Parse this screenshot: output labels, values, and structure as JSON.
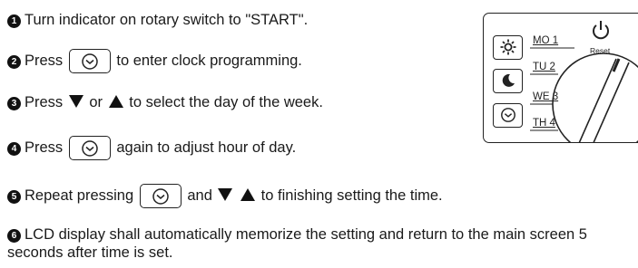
{
  "steps": {
    "s1": {
      "num": "1",
      "text": "Turn indicator on rotary switch to \"START\"."
    },
    "s2": {
      "num": "2",
      "before": "Press",
      "after": "to enter clock programming."
    },
    "s3": {
      "num": "3",
      "before": "Press",
      "mid": "or",
      "after": "to select the day of the week."
    },
    "s4": {
      "num": "4",
      "before": "Press",
      "after": "again to adjust hour of day."
    },
    "s5": {
      "num": "5",
      "before": "Repeat pressing",
      "mid": "and",
      "after": "to finishing setting the time."
    },
    "s6": {
      "num": "6",
      "text": "LCD display shall automatically memorize the setting and return to the main screen 5 seconds after time is set."
    }
  },
  "panel": {
    "days": [
      "MO 1",
      "TU 2",
      "WE 3",
      "TH 4"
    ],
    "reset_label": "Reset",
    "buttons": [
      "sun-icon",
      "moon-icon",
      "clock-icon"
    ]
  }
}
